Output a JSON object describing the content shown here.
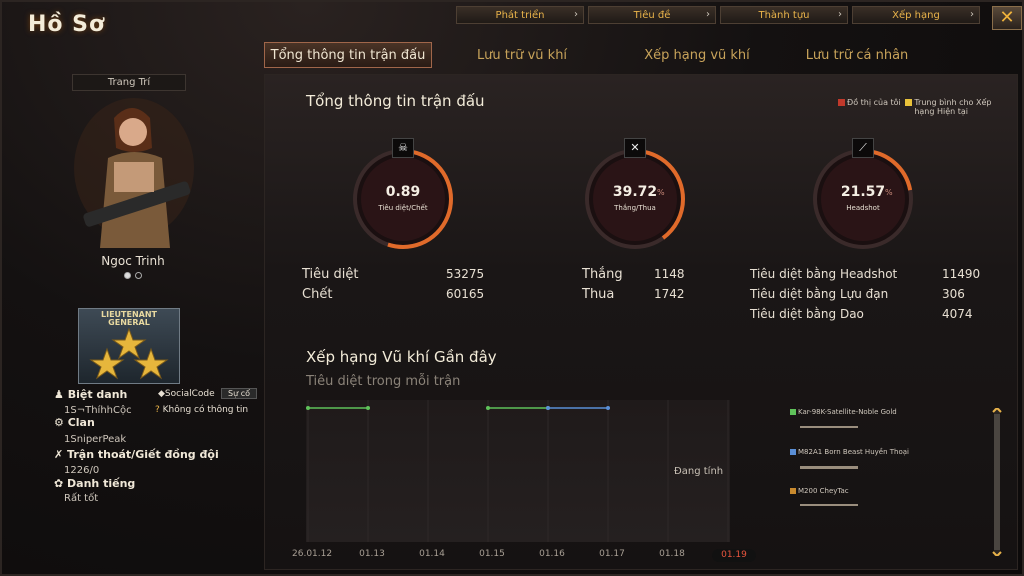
{
  "window": {
    "title": "Hồ Sơ",
    "close_glyph": "✕"
  },
  "top_nav": [
    {
      "label": "Phát triển"
    },
    {
      "label": "Tiêu đề"
    },
    {
      "label": "Thành tựu"
    },
    {
      "label": "Xếp hạng"
    }
  ],
  "tabs": [
    {
      "label": "Tổng thông tin trận đấu",
      "active": true
    },
    {
      "label": "Lưu trữ vũ khí"
    },
    {
      "label": "Xếp hạng vũ khí"
    },
    {
      "label": "Lưu trữ cá nhân"
    }
  ],
  "profile": {
    "deco_label": "Trang Trí",
    "char_name": "Ngoc Trinh",
    "rank_title": "LIEUTENANT GENERAL",
    "nickname_label": "Biệt danh",
    "nickname_value": "1S¬ThíhhCộc",
    "social_label": "SocialCode",
    "social_button": "Sự cố",
    "no_info": "Không có thông tin",
    "clan_label": "Clan",
    "clan_value": "1SniperPeak",
    "escape_label": "Trận thoát/Giết đồng đội",
    "escape_value": "1226/0",
    "rep_label": "Danh tiếng",
    "rep_value": "Rất tốt"
  },
  "overview": {
    "title": "Tổng thông tin trận đấu",
    "legend_mine": "Đồ thị của tôi",
    "legend_avg": "Trung bình cho Xếp hạng Hiện tại",
    "gauges": [
      {
        "value": "0.89",
        "label": "Tiêu diệt/Chết",
        "pct": "",
        "icon": "skull-icon",
        "fill": 0.55
      },
      {
        "value": "39.72",
        "label": "Thắng/Thua",
        "pct": "%",
        "icon": "crossed-guns-icon",
        "fill": 0.4
      },
      {
        "value": "21.57",
        "label": "Headshot",
        "pct": "%",
        "icon": "rifle-icon",
        "fill": 0.22
      }
    ],
    "stats": {
      "kills_label": "Tiêu diệt",
      "kills": "53275",
      "deaths_label": "Chết",
      "deaths": "60165",
      "wins_label": "Thắng",
      "wins": "1148",
      "losses_label": "Thua",
      "losses": "1742",
      "hs_label": "Tiêu diệt bằng Headshot",
      "hs": "11490",
      "grenade_label": "Tiêu diệt bằng Lựu đạn",
      "grenade": "306",
      "knife_label": "Tiêu diệt bằng Dao",
      "knife": "4074"
    }
  },
  "weapon_rank": {
    "title": "Xếp hạng Vũ khí Gần đây",
    "subtitle": "Tiêu diệt trong mỗi trận",
    "status": "Đang tính",
    "weapons": [
      {
        "name": "Kar-98K-Satellite-Noble Gold",
        "color": "#5fc25a"
      },
      {
        "name": "M82A1 Born Beast Huyền Thoại",
        "color": "#5a8fd6"
      },
      {
        "name": "M200 CheyTac",
        "color": "#c98a2e"
      }
    ]
  },
  "chart_data": {
    "type": "line",
    "x": [
      "26.01.12",
      "01.13",
      "01.14",
      "01.15",
      "01.16",
      "01.17",
      "01.18",
      "01.19"
    ],
    "current_x": "01.19",
    "series": [
      {
        "name": "Kar-98K-Satellite-Noble Gold",
        "color": "#5fc25a",
        "points": [
          [
            0,
            1
          ],
          [
            1,
            1
          ],
          [
            3,
            1
          ],
          [
            4,
            1
          ]
        ]
      },
      {
        "name": "M82A1 Born Beast Huyền Thoại",
        "color": "#5a8fd6",
        "points": [
          [
            4,
            1
          ],
          [
            5,
            1
          ]
        ]
      }
    ]
  }
}
